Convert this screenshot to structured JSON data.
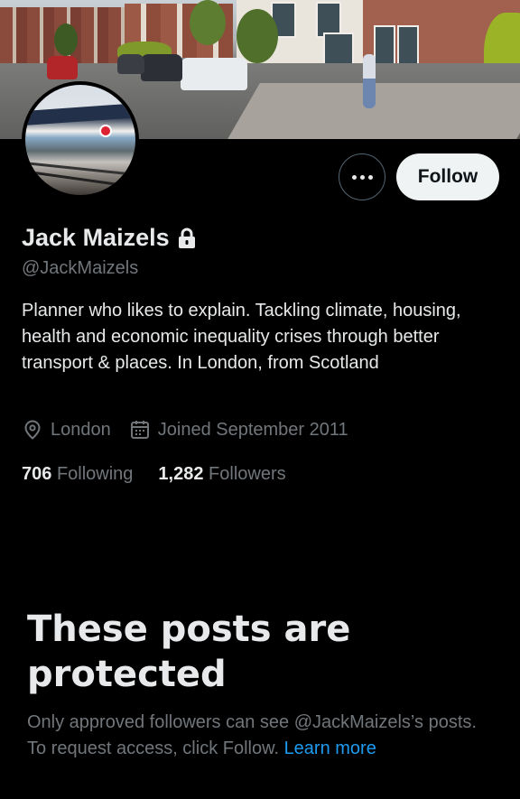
{
  "profile": {
    "name": "Jack Maizels",
    "handle": "@JackMaizels",
    "protected_icon": "lock-icon",
    "bio": "Planner who likes to explain. Tackling climate, housing, health and economic inequality crises through better transport & places. In London, from Scotland",
    "location": "London",
    "location_icon": "location-pin-icon",
    "joined": "Joined September 2011",
    "joined_icon": "calendar-icon",
    "following_count": "706",
    "following_label": "Following",
    "followers_count": "1,282",
    "followers_label": "Followers"
  },
  "actions": {
    "more_icon": "more-options-icon",
    "follow_label": "Follow"
  },
  "protected_notice": {
    "title": "These posts are protected",
    "text": "Only approved followers can see @JackMaizels’s posts. To request access, click Follow.",
    "link": "Learn more"
  },
  "colors": {
    "background": "#000000",
    "primary_text": "#e7e9ea",
    "secondary_text": "#71767b",
    "link": "#1d9bf0",
    "follow_button_bg": "#eff3f4"
  }
}
